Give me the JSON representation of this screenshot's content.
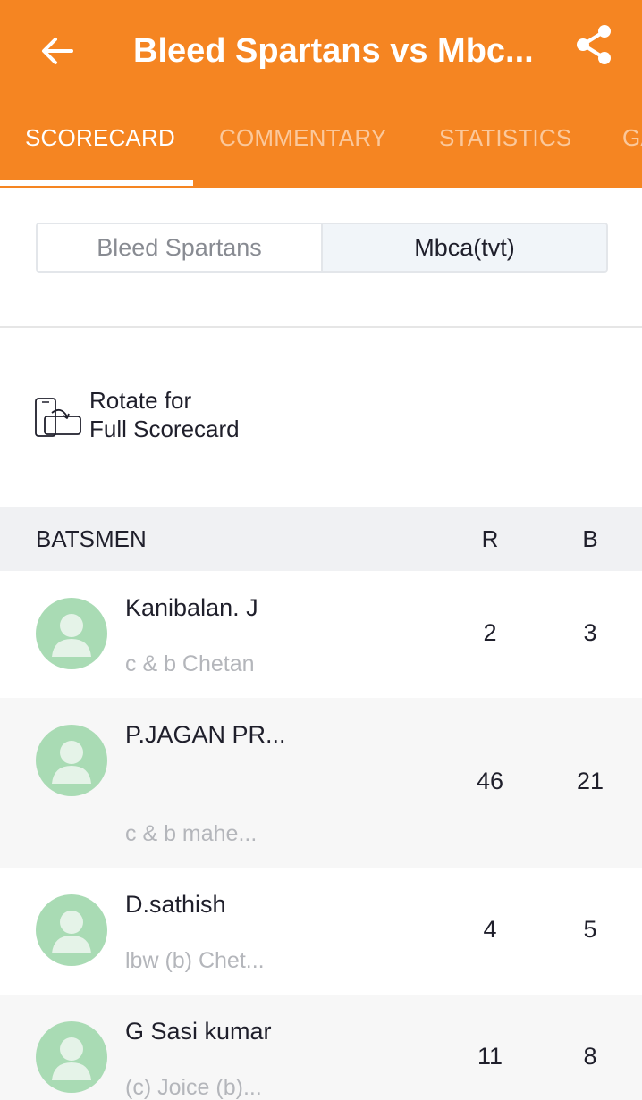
{
  "header": {
    "title": "Bleed Spartans vs Mbc...",
    "back_icon": "arrow-left-icon",
    "share_icon": "share-icon",
    "accent_color": "#f58522"
  },
  "tabs": [
    {
      "label": "SCORECARD",
      "active": true
    },
    {
      "label": "COMMENTARY",
      "active": false
    },
    {
      "label": "STATISTICS",
      "active": false
    },
    {
      "label": "GA",
      "active": false
    }
  ],
  "team_toggle": {
    "teams": [
      "Bleed Spartans",
      "Mbca(tvt)"
    ],
    "selected": "Mbca(tvt)"
  },
  "rotate_hint": {
    "line1": "Rotate for",
    "line2": "Full Scorecard",
    "icon": "rotate-phone-icon"
  },
  "batting": {
    "headers": {
      "batsmen": "BATSMEN",
      "runs": "R",
      "balls": "B"
    },
    "rows": [
      {
        "name": "Kanibalan. J",
        "dismissal": "c & b Chetan",
        "runs": "2",
        "balls": "3"
      },
      {
        "name": "P.JAGAN PR...",
        "dismissal": "c & b mahe...",
        "runs": "46",
        "balls": "21"
      },
      {
        "name": "D.sathish",
        "dismissal": "lbw (b) Chet...",
        "runs": "4",
        "balls": "5"
      },
      {
        "name": "G Sasi kumar",
        "dismissal": "(c) Joice (b)...",
        "runs": "11",
        "balls": "8"
      }
    ]
  }
}
